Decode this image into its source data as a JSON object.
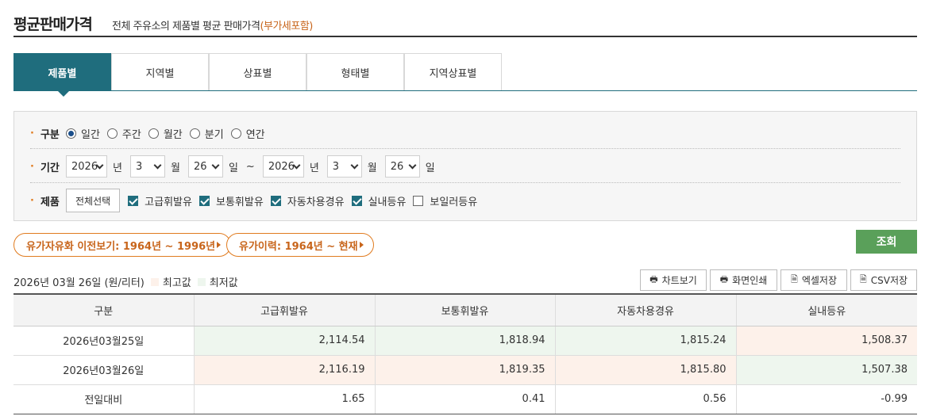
{
  "header": {
    "title": "평균판매가격",
    "subtitle": "전체 주유소의 제품별 평균 판매가격",
    "subtitle_highlight": "(부가세포함)"
  },
  "tabs": [
    "제품별",
    "지역별",
    "상표별",
    "형태별",
    "지역상표별"
  ],
  "search": {
    "division_label": "구분",
    "division_options": [
      "일간",
      "주간",
      "월간",
      "분기",
      "연간"
    ],
    "division_selected": "일간",
    "period_label": "기간",
    "start": {
      "year": "2026",
      "month": "3",
      "day": "26"
    },
    "end": {
      "year": "2026",
      "month": "3",
      "day": "26"
    },
    "year_unit": "년",
    "month_unit": "월",
    "day_unit": "일",
    "range_sep": "~",
    "product_label": "제품",
    "select_all": "전체선택",
    "products": [
      {
        "label": "고급휘발유",
        "checked": true
      },
      {
        "label": "보통휘발유",
        "checked": true
      },
      {
        "label": "자동차용경유",
        "checked": true
      },
      {
        "label": "실내등유",
        "checked": true
      },
      {
        "label": "보일러등유",
        "checked": false
      }
    ],
    "submit": "조회"
  },
  "history": {
    "pre": "유가자유화 이전보기: 1964년 ~ 1996년",
    "hist": "유가이력: 1964년 ~ 현재"
  },
  "info": {
    "date_unit": "2026년 03월 26일 (원/리터)",
    "legend_high": "최고값",
    "legend_low": "최저값",
    "colors": {
      "high": "#fdf1ea",
      "low": "#eef6ee"
    }
  },
  "toolbar": {
    "chart": "차트보기",
    "print": "화면인쇄",
    "excel": "엑셀저장",
    "csv": "CSV저장"
  },
  "table": {
    "headers": [
      "구분",
      "고급휘발유",
      "보통휘발유",
      "자동차용경유",
      "실내등유"
    ],
    "rows": [
      {
        "label": "2026년03월25일",
        "values": [
          "2,114.54",
          "1,818.94",
          "1,815.24",
          "1,508.37"
        ],
        "marks": [
          "low",
          "low",
          "low",
          "high"
        ]
      },
      {
        "label": "2026년03월26일",
        "values": [
          "2,116.19",
          "1,819.35",
          "1,815.80",
          "1,507.38"
        ],
        "marks": [
          "high",
          "high",
          "high",
          "low"
        ]
      },
      {
        "label": "전일대비",
        "values": [
          "1.65",
          "0.41",
          "0.56",
          "-0.99"
        ],
        "marks": [
          "",
          "",
          "",
          ""
        ]
      }
    ]
  }
}
